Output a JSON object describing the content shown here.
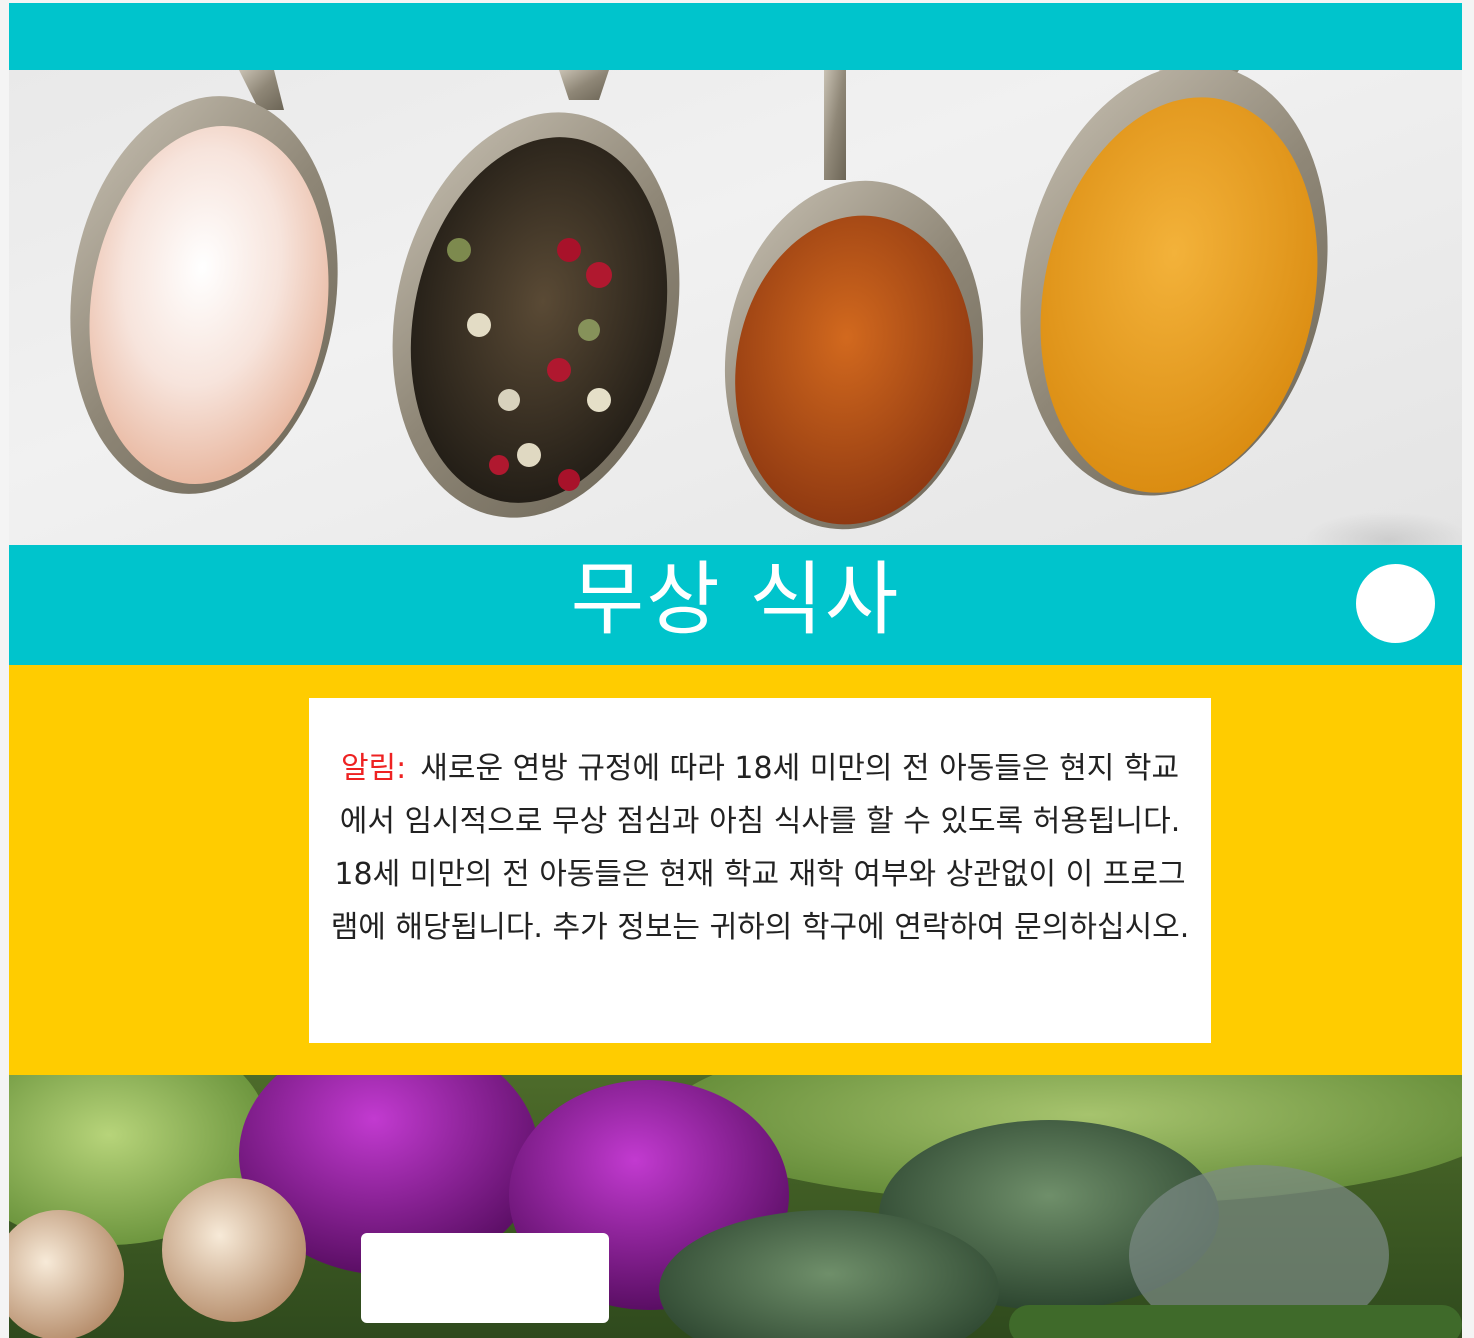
{
  "title": "무상 식사",
  "notice": {
    "label": "알림:",
    "text": "새로운 연방 규정에 따라 18세 미만의 전 아동들은 현지 학교에서 임시적으로 무상 점심과 아침 식사를 할 수 있도록 허용됩니다. 18세 미만의 전 아동들은 현재 학교 재학 여부와 상관없이 이 프로그램에 해당됩니다. 추가 정보는 귀하의 학구에 연락하여 문의하십시오."
  },
  "colors": {
    "teal": "#00c4cc",
    "yellow": "#ffcc00",
    "notice_label": "#ee2222"
  },
  "images": {
    "top": "spices-in-spoons-photo",
    "bottom": "fresh-vegetables-photo"
  }
}
